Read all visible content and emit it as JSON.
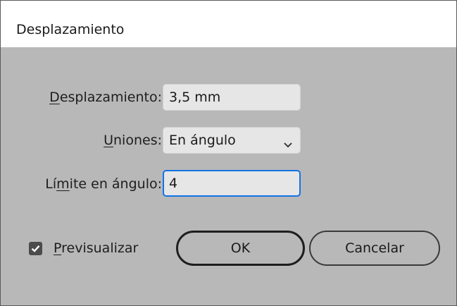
{
  "window": {
    "title": "Desplazamiento"
  },
  "form": {
    "offset": {
      "label_mnemonic": "D",
      "label_rest": "esplazamiento:",
      "value": "3,5 mm"
    },
    "joins": {
      "label_mnemonic": "U",
      "label_rest": "niones:",
      "selected": "En ángulo"
    },
    "miter_limit": {
      "label_prefix": "Lí",
      "label_mnemonic": "m",
      "label_rest": "ite en ángulo:",
      "value": "4"
    }
  },
  "preview": {
    "label_mnemonic": "P",
    "label_rest": "revisualizar",
    "checked": true
  },
  "buttons": {
    "ok_label": "OK",
    "cancel_label": "Cancelar"
  },
  "icons": {
    "select_arrow": "chevron-down-icon",
    "checkbox_mark": "checkmark-icon"
  }
}
